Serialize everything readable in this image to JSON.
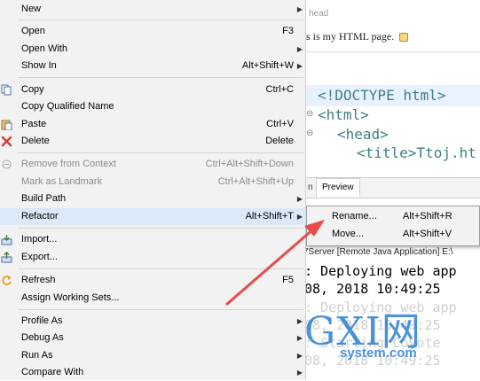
{
  "background": {
    "head_label": "head",
    "html_text": "s is my HTML page.",
    "code_lines": [
      "<!DOCTYPE html>",
      "<html>",
      "<head>",
      "<title>Ttoj.ht"
    ],
    "tab_source_fragment": "n",
    "tab_preview": "Preview",
    "pr_fragment": "Pr",
    "console_title": "7Server [Remote Java Application] E:\\",
    "console_lines": [
      ": Deploying web app",
      "08, 2018 10:49:25"
    ],
    "console_ghost_lines": [
      ": Deploying web app",
      "08, 2018 10:49:25",
      ": Starting Coyote",
      "08, 2018 10:49:25"
    ]
  },
  "watermark": {
    "main": "GXI网",
    "sub": "system.com"
  },
  "menu": {
    "items": [
      {
        "label": "New",
        "shortcut": "",
        "submenu": true,
        "icon": ""
      },
      {
        "label": "Open",
        "shortcut": "F3",
        "submenu": false,
        "icon": ""
      },
      {
        "label": "Open With",
        "shortcut": "",
        "submenu": true,
        "icon": ""
      },
      {
        "label": "Show In",
        "shortcut": "Alt+Shift+W",
        "submenu": true,
        "icon": ""
      },
      {
        "label": "Copy",
        "shortcut": "Ctrl+C",
        "submenu": false,
        "icon": "copy-icon"
      },
      {
        "label": "Copy Qualified Name",
        "shortcut": "",
        "submenu": false,
        "icon": ""
      },
      {
        "label": "Paste",
        "shortcut": "Ctrl+V",
        "submenu": false,
        "icon": "paste-icon"
      },
      {
        "label": "Delete",
        "shortcut": "Delete",
        "submenu": false,
        "icon": "delete-icon"
      },
      {
        "label": "Remove from Context",
        "shortcut": "Ctrl+Alt+Shift+Down",
        "submenu": false,
        "icon": "remove-context-icon",
        "disabled": true
      },
      {
        "label": "Mark as Landmark",
        "shortcut": "Ctrl+Alt+Shift+Up",
        "submenu": false,
        "icon": "",
        "disabled": true
      },
      {
        "label": "Build Path",
        "shortcut": "",
        "submenu": true,
        "icon": ""
      },
      {
        "label": "Refactor",
        "shortcut": "Alt+Shift+T",
        "submenu": true,
        "icon": "",
        "active": true
      },
      {
        "label": "Import...",
        "shortcut": "",
        "submenu": false,
        "icon": "import-icon"
      },
      {
        "label": "Export...",
        "shortcut": "",
        "submenu": false,
        "icon": "export-icon"
      },
      {
        "label": "Refresh",
        "shortcut": "F5",
        "submenu": false,
        "icon": "refresh-icon"
      },
      {
        "label": "Assign Working Sets...",
        "shortcut": "",
        "submenu": false,
        "icon": ""
      },
      {
        "label": "Profile As",
        "shortcut": "",
        "submenu": true,
        "icon": ""
      },
      {
        "label": "Debug As",
        "shortcut": "",
        "submenu": true,
        "icon": ""
      },
      {
        "label": "Run As",
        "shortcut": "",
        "submenu": true,
        "icon": ""
      },
      {
        "label": "Compare With",
        "shortcut": "",
        "submenu": true,
        "icon": ""
      }
    ]
  },
  "submenu": {
    "items": [
      {
        "label": "Rename...",
        "shortcut": "Alt+Shift+R"
      },
      {
        "label": "Move...",
        "shortcut": "Alt+Shift+V"
      }
    ]
  },
  "colors": {
    "menu_bg": "#f2f2f2",
    "hover": "#dbe8f7",
    "annotation_arrow": "#e84a4a",
    "watermark": "#2a7fd6",
    "code_tag": "#3f7f7f"
  }
}
